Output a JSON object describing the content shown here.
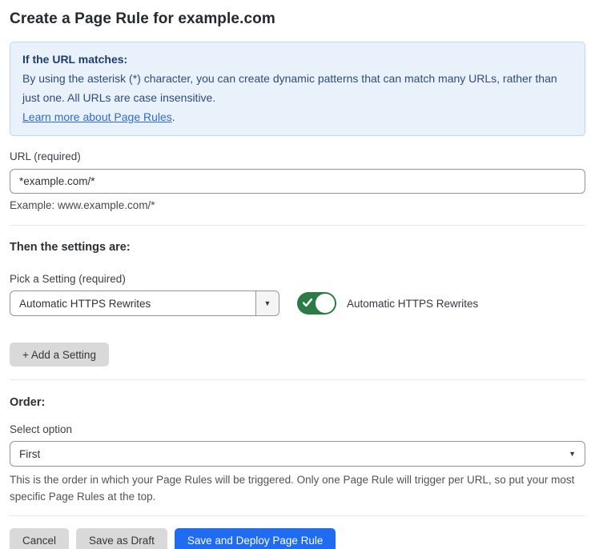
{
  "page": {
    "title": "Create a Page Rule for example.com"
  },
  "info_box": {
    "heading": "If the URL matches:",
    "body": "By using the asterisk (*) character, you can create dynamic patterns that can match many URLs, rather than just one. All URLs are case insensitive.",
    "link": "Learn more about Page Rules",
    "link_suffix": "."
  },
  "url_field": {
    "label": "URL (required)",
    "value": "*example.com/*",
    "example": "Example: www.example.com/*"
  },
  "settings_section": {
    "heading": "Then the settings are:",
    "picker_label": "Pick a Setting (required)",
    "picker_value": "Automatic HTTPS Rewrites",
    "picker_caret_icon": "▼",
    "toggle_state": "on",
    "toggle_label": "Automatic HTTPS Rewrites",
    "add_setting_label": "+ Add a Setting"
  },
  "order_section": {
    "heading": "Order:",
    "select_label": "Select option",
    "select_value": "First",
    "select_caret_icon": "▼",
    "help_text": "This is the order in which your Page Rules will be triggered. Only one Page Rule will trigger per URL, so put your most specific Page Rules at the top."
  },
  "footer": {
    "cancel_label": "Cancel",
    "save_draft_label": "Save as Draft",
    "save_deploy_label": "Save and Deploy Page Rule"
  },
  "colors": {
    "toggle_on_green": "#2c7b46",
    "primary_button_blue": "#1f6cf0",
    "info_box_background": "#e9f2fb",
    "info_box_border": "#bcd8f2",
    "info_text_navy": "#2f4b7d",
    "link_blue": "#3069da",
    "gray_button": "#d9d9d9"
  }
}
